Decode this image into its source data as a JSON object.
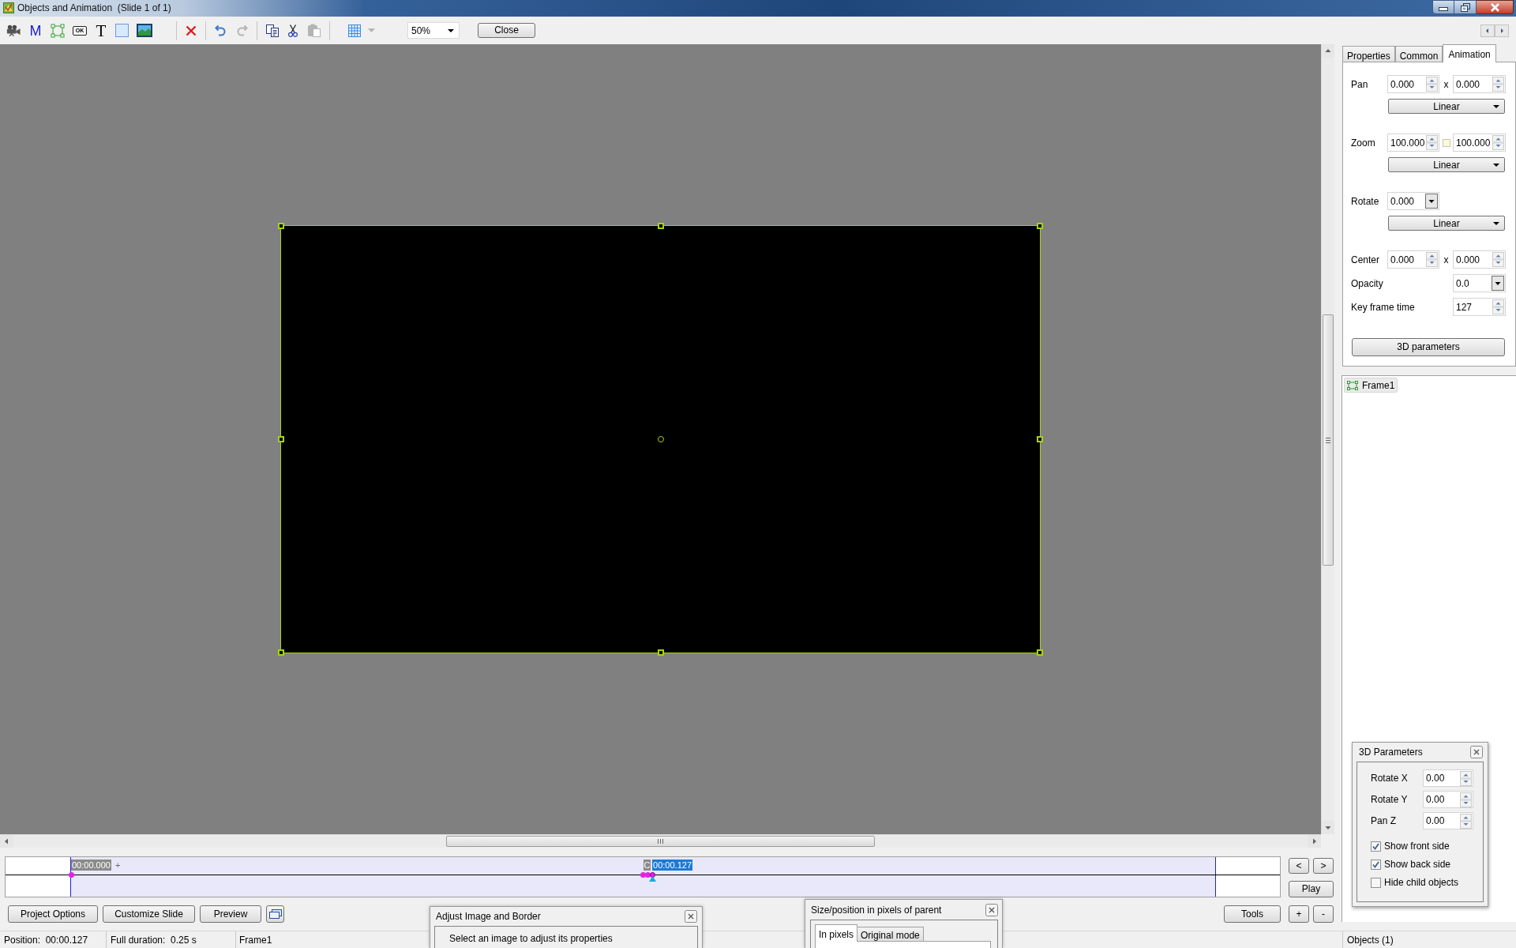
{
  "window": {
    "title": "Objects and Animation  (Slide 1 of 1)"
  },
  "toolbar": {
    "tool_groups": [
      [
        {
          "kind": "camera",
          "disabled": false
        },
        {
          "kind": "mask",
          "glyph": "M",
          "disabled": false
        },
        {
          "kind": "frame",
          "disabled": false
        },
        {
          "kind": "button",
          "glyph": "OK",
          "disabled": false
        },
        {
          "kind": "text",
          "glyph": "T",
          "disabled": false
        },
        {
          "kind": "rectangle",
          "disabled": false
        },
        {
          "kind": "image",
          "disabled": false
        }
      ],
      [
        {
          "kind": "delete",
          "disabled": false
        }
      ],
      [
        {
          "kind": "undo",
          "disabled": false
        },
        {
          "kind": "redo",
          "disabled": true
        }
      ],
      [
        {
          "kind": "copy",
          "disabled": false
        },
        {
          "kind": "cut",
          "disabled": false
        },
        {
          "kind": "paste",
          "disabled": true
        }
      ],
      [
        {
          "kind": "grid",
          "disabled": false
        },
        {
          "kind": "grid-menu",
          "disabled": true
        }
      ]
    ],
    "zoom": "50%",
    "close_button": "Close"
  },
  "canvas": {
    "frame": {
      "selected": true
    }
  },
  "properties_panel": {
    "tabs": [
      {
        "label": "Properties",
        "selected": false
      },
      {
        "label": "Common",
        "selected": false
      },
      {
        "label": "Animation",
        "selected": true
      }
    ],
    "fields": [
      {
        "kind": "pair",
        "label": "Pan",
        "values": [
          "0.000",
          "0.000"
        ],
        "separator": "x",
        "easing": "Linear"
      },
      {
        "kind": "pair",
        "label": "Zoom",
        "values": [
          "100.000",
          "100.000"
        ],
        "linked": false,
        "easing": "Linear"
      },
      {
        "kind": "combo",
        "label": "Rotate",
        "value": "0.000",
        "easing": "Linear"
      },
      {
        "kind": "pair",
        "label": "Center",
        "values": [
          "0.000",
          "0.000"
        ],
        "separator": "x"
      },
      {
        "kind": "right-combo",
        "label": "Opacity",
        "value": "0.0"
      },
      {
        "kind": "right-spin",
        "label": "Key frame time",
        "value": "127"
      }
    ],
    "button": "3D parameters"
  },
  "objects_list": {
    "items": [
      {
        "name": "Frame1",
        "selected": true
      }
    ]
  },
  "parameters_3d": {
    "title": "3D Parameters",
    "fields": [
      {
        "label": "Rotate X",
        "value": "0.00"
      },
      {
        "label": "Rotate Y",
        "value": "0.00"
      },
      {
        "label": "Pan Z",
        "value": "0.00"
      }
    ],
    "options": [
      {
        "label": "Show front side",
        "checked": true
      },
      {
        "label": "Show back side",
        "checked": true
      },
      {
        "label": "Hide child objects",
        "checked": false
      }
    ]
  },
  "timeline": {
    "playhead": {
      "level": 0.508
    },
    "keyframes": [
      {
        "level": 0,
        "label": "00:00.000",
        "selected": false
      },
      {
        "level": 0.5,
        "label": "C",
        "selected": false
      },
      {
        "level": 0.504,
        "selected": false
      },
      {
        "level": 0.508,
        "label": "00:00.127",
        "selected": true
      }
    ],
    "add_mark": "+",
    "previous_button": "<",
    "next_button": ">",
    "play_button": "Play"
  },
  "footer": {
    "left_buttons": [
      "Project Options",
      "Customize Slide",
      "Preview"
    ],
    "tools_button": "Tools",
    "add_button": "+",
    "remove_button": "-"
  },
  "status_bar": {
    "sections": [
      "Position:  00:00.127",
      "Full duration:  0.25 s",
      "Frame1"
    ],
    "objects": "Objects (1)"
  },
  "adjust_window": {
    "title": "Adjust Image and Border",
    "message": "Select an image to adjust its properties"
  },
  "size_window": {
    "title": "Size/position in pixels of parent",
    "tabs": [
      {
        "label": "In pixels",
        "selected": true
      },
      {
        "label": "Original mode",
        "selected": false
      }
    ]
  }
}
